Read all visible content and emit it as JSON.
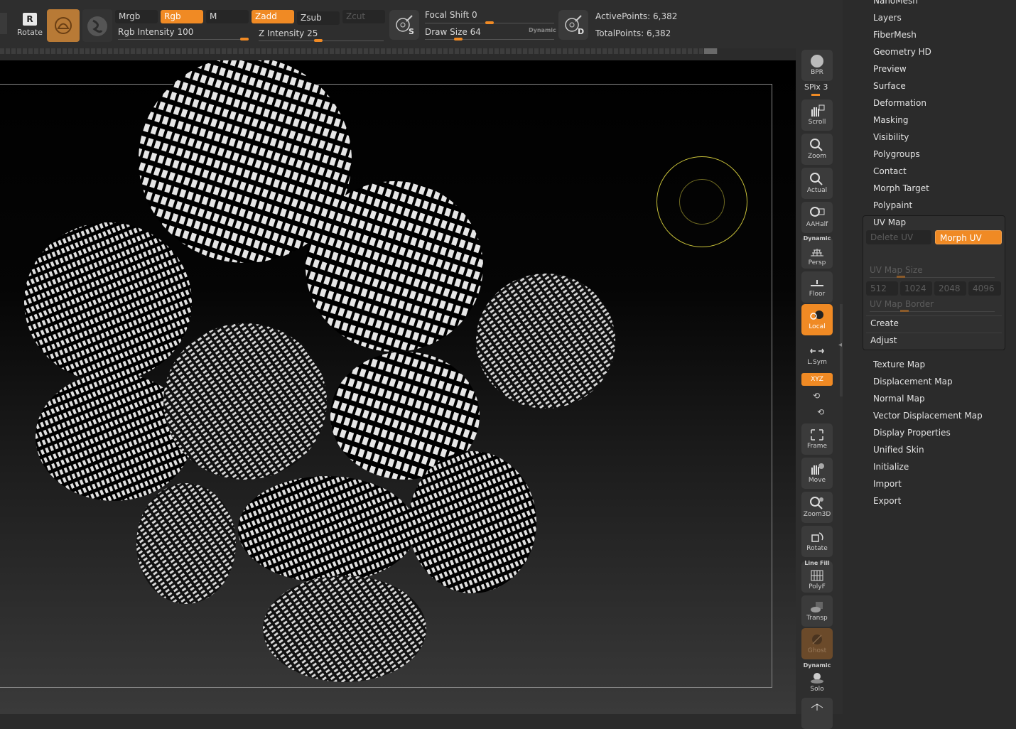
{
  "toolbar": {
    "rotate_label": "Rotate",
    "rotate_glyph": "R",
    "mrgb": "Mrgb",
    "rgb": "Rgb",
    "m": "M",
    "zadd": "Zadd",
    "zsub": "Zsub",
    "zcut": "Zcut",
    "rgb_intensity_label": "Rgb Intensity",
    "rgb_intensity_value": "100",
    "rgb_intensity_level": 1.0,
    "z_intensity_label": "Z Intensity",
    "z_intensity_value": "25",
    "z_intensity_level": 0.25,
    "focal_shift_label": "Focal Shift",
    "focal_shift_value": "0",
    "draw_size_label": "Draw Size",
    "draw_size_value": "64",
    "dynamic_label": "Dynamic",
    "btn_s_letter": "S",
    "btn_d_letter": "D",
    "active_points_label": "ActivePoints:",
    "active_points_value": "6,382",
    "total_points_label": "TotalPoints:",
    "total_points_value": "6,382",
    "accent_color": "#f08a24"
  },
  "shelf": {
    "bpr": "BPR",
    "spix": "SPix 3",
    "scroll": "Scroll",
    "zoom": "Zoom",
    "actual": "Actual",
    "aahalf": "AAHalf",
    "dynamic_tag": "Dynamic",
    "persp": "Persp",
    "floor": "Floor",
    "local": "Local",
    "lsym": "L.Sym",
    "xyz": "XYZ",
    "frame": "Frame",
    "move": "Move",
    "zoom3d": "Zoom3D",
    "rotate": "Rotate",
    "linefill_tag": "Line Fill",
    "polyf": "PolyF",
    "transp": "Transp",
    "ghost": "Ghost",
    "solo_tag": "Dynamic",
    "solo": "Solo"
  },
  "menu": {
    "items_top": [
      "NanoMesh",
      "Layers",
      "FiberMesh",
      "Geometry HD",
      "Preview",
      "Surface",
      "Deformation",
      "Masking",
      "Visibility",
      "Polygroups",
      "Contact",
      "Morph Target",
      "Polypaint"
    ],
    "uv_map": {
      "title": "UV Map",
      "delete_uv": "Delete UV",
      "morph_uv": "Morph UV",
      "size_label": "UV Map Size",
      "sizes": [
        "512",
        "1024",
        "2048",
        "4096"
      ],
      "border_label": "UV Map Border",
      "create": "Create",
      "adjust": "Adjust"
    },
    "items_bottom": [
      "Texture Map",
      "Displacement Map",
      "Normal Map",
      "Vector Displacement Map",
      "Display Properties",
      "Unified Skin",
      "Initialize",
      "Import",
      "Export"
    ]
  }
}
